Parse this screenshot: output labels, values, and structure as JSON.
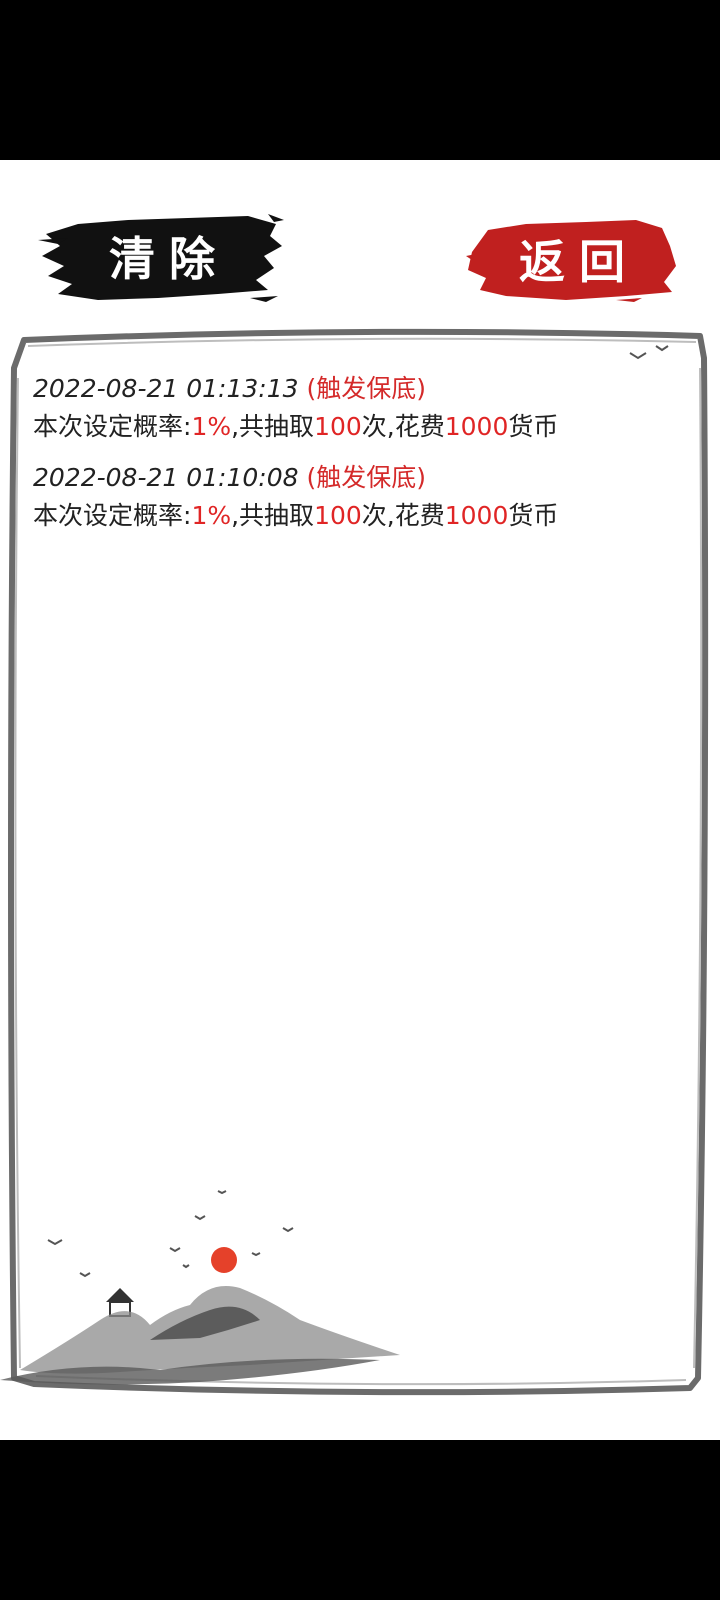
{
  "toolbar": {
    "clear_label": "清除",
    "back_label": "返回"
  },
  "records": [
    {
      "timestamp": "2022-08-21 01:13:13",
      "tag": "(触发保底)",
      "prefix": "本次设定概率:",
      "rate": "1%",
      "mid1": ",共抽取",
      "count": "100",
      "mid2": "次,花费",
      "cost": "1000",
      "suffix": "货币"
    },
    {
      "timestamp": "2022-08-21 01:10:08",
      "tag": "(触发保底)",
      "prefix": "本次设定概率:",
      "rate": "1%",
      "mid1": ",共抽取",
      "count": "100",
      "mid2": "次,花费",
      "cost": "1000",
      "suffix": "货币"
    }
  ],
  "colors": {
    "accent_red": "#e02525",
    "back_button_red": "#c0201f",
    "clear_button_black": "#111111"
  }
}
